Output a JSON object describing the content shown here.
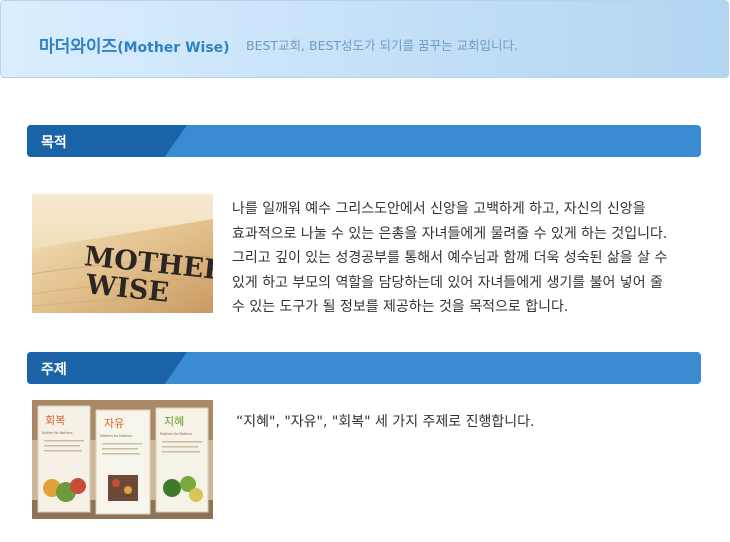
{
  "header": {
    "title_ko": "마더와이즈",
    "title_en": "(Mother Wise)",
    "tagline": "BEST교회, BEST성도가 되기를 꿈꾸는 교회입니다."
  },
  "sections": [
    {
      "heading": "목적",
      "photo_text": [
        "MOTHER",
        "WISE"
      ],
      "lines": [
        "나를 일깨워 예수 그리스도안에서 신앙을 고백하게 하고, 자신의 신앙을",
        "효과적으로 나눌 수 있는 은총을 자녀들에게 물려줄 수 있게 하는 것입니다.",
        "그리고 깊이 있는 성경공부를 통해서 예수님과 함께 더욱 성숙된 삶을 살 수",
        "있게 하고 부모의 역할을 담당하는데 있어 자녀들에게 생기를 불어 넣어 줄",
        "수 있는 도구가 될 정보를 제공하는 것을 목적으로 합니다."
      ]
    },
    {
      "heading": "주제",
      "banners": [
        {
          "title": "회복",
          "subtitle": "Mother for Mothers",
          "color": "#d8642a"
        },
        {
          "title": "자유",
          "subtitle": "Mothers for Mothers",
          "color": "#d8642a"
        },
        {
          "title": "지혜",
          "subtitle": "Mothers for Mothers",
          "color": "#6a9a2a"
        }
      ],
      "lines": [
        "“지혜\", \"자유\", \"회복\" 세 가지 주제로 진행합니다."
      ]
    }
  ],
  "colors": {
    "bar_light": "#3a8bd1",
    "bar_dark": "#1a63a8",
    "header_title": "#2e82c4",
    "header_tagline": "#6e9bc4"
  }
}
